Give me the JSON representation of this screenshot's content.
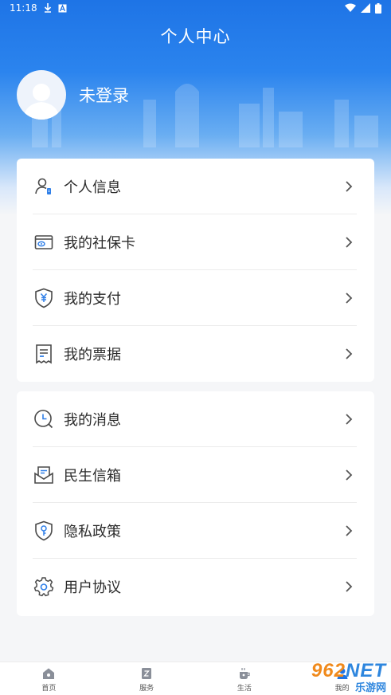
{
  "status_bar": {
    "time": "11:18",
    "icons": [
      "download-icon",
      "a-badge-icon",
      "wifi-icon",
      "signal-icon",
      "battery-icon"
    ]
  },
  "header": {
    "title": "个人中心"
  },
  "profile": {
    "login_label": "未登录"
  },
  "menu_groups": [
    {
      "items": [
        {
          "label": "个人信息",
          "icon": "user-info-icon"
        },
        {
          "label": "我的社保卡",
          "icon": "social-card-icon"
        },
        {
          "label": "我的支付",
          "icon": "payment-shield-icon"
        },
        {
          "label": "我的票据",
          "icon": "receipt-icon"
        }
      ]
    },
    {
      "items": [
        {
          "label": "我的消息",
          "icon": "message-clock-icon"
        },
        {
          "label": "民生信箱",
          "icon": "mailbox-icon"
        },
        {
          "label": "隐私政策",
          "icon": "privacy-shield-icon"
        },
        {
          "label": "用户协议",
          "icon": "settings-gear-icon"
        }
      ]
    }
  ],
  "tabbar": {
    "tabs": [
      {
        "label": "首页",
        "icon": "home-icon"
      },
      {
        "label": "服务",
        "icon": "service-icon"
      },
      {
        "label": "生活",
        "icon": "life-cup-icon"
      },
      {
        "label": "我的",
        "icon": "me-icon"
      }
    ]
  },
  "watermark": {
    "main_num": "962",
    "main_net": "NET",
    "sub": "乐游网"
  },
  "colors": {
    "primary_blue": "#1e74e6",
    "icon_gray": "#4a4a4a",
    "icon_accent": "#2f7fe8"
  }
}
